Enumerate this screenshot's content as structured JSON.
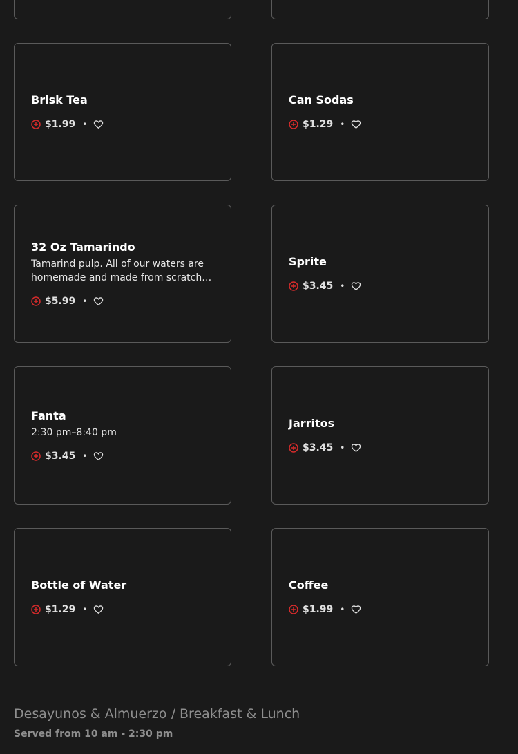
{
  "colors": {
    "background": "#1a1a1a",
    "border": "#5a5a5a",
    "accent": "#d62b2b",
    "muted": "#8e8e8e"
  },
  "icons": {
    "add": "plus-circle-icon",
    "favorite": "heart-icon"
  },
  "menu_items": [
    {
      "name": "Brisk Tea",
      "description": "",
      "price": "$1.99"
    },
    {
      "name": "Can Sodas",
      "description": "",
      "price": "$1.29"
    },
    {
      "name": "32 Oz Tamarindo",
      "description": "Tamarind pulp. All of our waters are homemade and made from scratch no artificial flavors.",
      "price": "$5.99"
    },
    {
      "name": "Sprite",
      "description": "",
      "price": "$3.45"
    },
    {
      "name": "Fanta",
      "description": "2:30 pm–8:40 pm",
      "price": "$3.45"
    },
    {
      "name": "Jarritos",
      "description": "",
      "price": "$3.45"
    },
    {
      "name": "Bottle of Water",
      "description": "",
      "price": "$1.29"
    },
    {
      "name": "Coffee",
      "description": "",
      "price": "$1.99"
    }
  ],
  "separator": "•",
  "next_section": {
    "title": "Desayunos & Almuerzo / Breakfast & Lunch",
    "subtitle": "Served from 10 am - 2:30 pm"
  }
}
